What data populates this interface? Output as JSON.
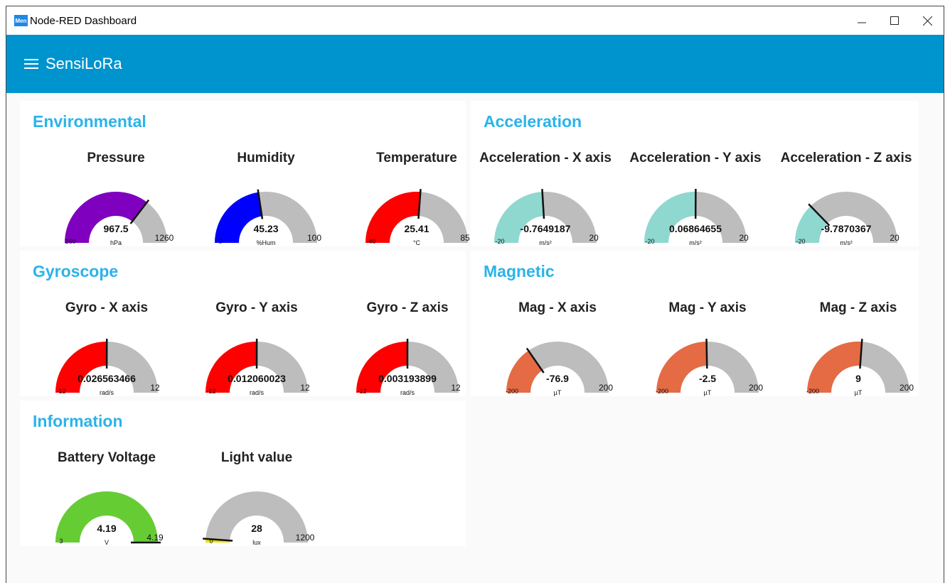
{
  "window": {
    "title": "Node-RED Dashboard",
    "icon_text": "Men"
  },
  "toolbar": {
    "app_name": "SensiLoRa"
  },
  "cards": [
    {
      "id": "environmental",
      "title": "Environmental",
      "gauges": [
        {
          "label": "Pressure",
          "value": "967.5",
          "unit": "hPa",
          "min": "260",
          "max": "1260",
          "fraction": 0.7075,
          "color": "#8000c0"
        },
        {
          "label": "Humidity",
          "value": "45.23",
          "unit": "%Hum",
          "min": "0",
          "max": "100",
          "fraction": 0.4523,
          "color": "#0000ff"
        },
        {
          "label": "Temperature",
          "value": "25.41",
          "unit": "°C",
          "min": "-40",
          "max": "85",
          "fraction": 0.5233,
          "color": "#ff0000"
        }
      ]
    },
    {
      "id": "acceleration",
      "title": "Acceleration",
      "gauges": [
        {
          "label": "Acceleration - X axis",
          "value": "-0.7649187",
          "unit": "m/s²",
          "min": "-20",
          "max": "20",
          "fraction": 0.4809,
          "color": "#8ed8d0"
        },
        {
          "label": "Acceleration - Y axis",
          "value": "0.06864655",
          "unit": "m/s²",
          "min": "-20",
          "max": "20",
          "fraction": 0.5017,
          "color": "#8ed8d0"
        },
        {
          "label": "Acceleration - Z axis",
          "value": "-9.7870367",
          "unit": "m/s²",
          "min": "-20",
          "max": "20",
          "fraction": 0.2553,
          "color": "#8ed8d0"
        }
      ]
    },
    {
      "id": "gyroscope",
      "title": "Gyroscope",
      "gauges": [
        {
          "label": "Gyro - X axis",
          "value": "0.026563466",
          "unit": "rad/s",
          "min": "-12",
          "max": "12",
          "fraction": 0.5011,
          "color": "#ff0000"
        },
        {
          "label": "Gyro - Y axis",
          "value": "0.012060023",
          "unit": "rad/s",
          "min": "-12",
          "max": "12",
          "fraction": 0.5005,
          "color": "#ff0000"
        },
        {
          "label": "Gyro - Z axis",
          "value": "0.003193899",
          "unit": "rad/s",
          "min": "-12",
          "max": "12",
          "fraction": 0.5001,
          "color": "#ff0000"
        }
      ]
    },
    {
      "id": "magnetic",
      "title": "Magnetic",
      "gauges": [
        {
          "label": "Mag - X axis",
          "value": "-76.9",
          "unit": "µT",
          "min": "-200",
          "max": "200",
          "fraction": 0.3078,
          "color": "#e56b45"
        },
        {
          "label": "Mag - Y axis",
          "value": "-2.5",
          "unit": "µT",
          "min": "-200",
          "max": "200",
          "fraction": 0.4938,
          "color": "#e56b45"
        },
        {
          "label": "Mag - Z axis",
          "value": "9",
          "unit": "µT",
          "min": "-200",
          "max": "200",
          "fraction": 0.5225,
          "color": "#e56b45"
        }
      ]
    },
    {
      "id": "information",
      "title": "Information",
      "gauges": [
        {
          "label": "Battery Voltage",
          "value": "4.19",
          "unit": "V",
          "min": "3",
          "max": "4.19",
          "fraction": 1.0,
          "color": "#66cc33"
        },
        {
          "label": "Light value",
          "value": "28",
          "unit": "lux",
          "min": "0",
          "max": "1200",
          "fraction": 0.0233,
          "color": "#e5e500"
        }
      ]
    }
  ]
}
